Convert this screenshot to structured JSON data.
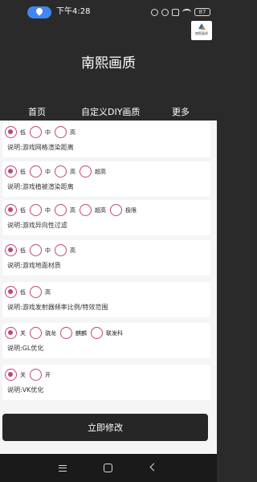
{
  "status_bar": {
    "time": "下午4:28",
    "battery": "87",
    "icons": [
      "location-icon",
      "vibrate-icon",
      "alarm-icon",
      "mail-icon",
      "wifi-icon",
      "battery-icon"
    ]
  },
  "header": {
    "title": "南熙画质",
    "logo_text": "南熙画质",
    "logo_colors": [
      "#2c6aa8",
      "#e07a2a"
    ]
  },
  "tabs": [
    {
      "label": "首页"
    },
    {
      "label": "自定义DIY画质"
    },
    {
      "label": "更多"
    }
  ],
  "settings": [
    {
      "options": [
        "低",
        "中",
        "高"
      ],
      "selected": 0,
      "description": "说明:游戏网格渲染距离"
    },
    {
      "options": [
        "低",
        "中",
        "高",
        "超高"
      ],
      "selected": 0,
      "description": "说明:游戏植被渲染距离"
    },
    {
      "options": [
        "低",
        "中",
        "高",
        "超高",
        "极限"
      ],
      "selected": 0,
      "description": "说明:游戏异向性过滤"
    },
    {
      "options": [
        "低",
        "中",
        "高"
      ],
      "selected": 0,
      "description": "说明:游戏地面材质"
    },
    {
      "options": [
        "低",
        "高"
      ],
      "selected": 0,
      "description": "说明:游戏发射器频率比例/特效范围"
    },
    {
      "options": [
        "关",
        "骁龙",
        "麒麟",
        "联发科"
      ],
      "selected": 0,
      "description": "说明:GL优化"
    },
    {
      "options": [
        "关",
        "开"
      ],
      "selected": 0,
      "description": "说明:VK优化"
    }
  ],
  "apply_button": {
    "label": "立即修改"
  },
  "theme": {
    "accent": "#c2457a",
    "dark": "#2a2a2a",
    "location_pill": "#3f86f5"
  },
  "nav_bar": {
    "icons": [
      "menu-icon",
      "home-icon",
      "back-icon"
    ]
  }
}
